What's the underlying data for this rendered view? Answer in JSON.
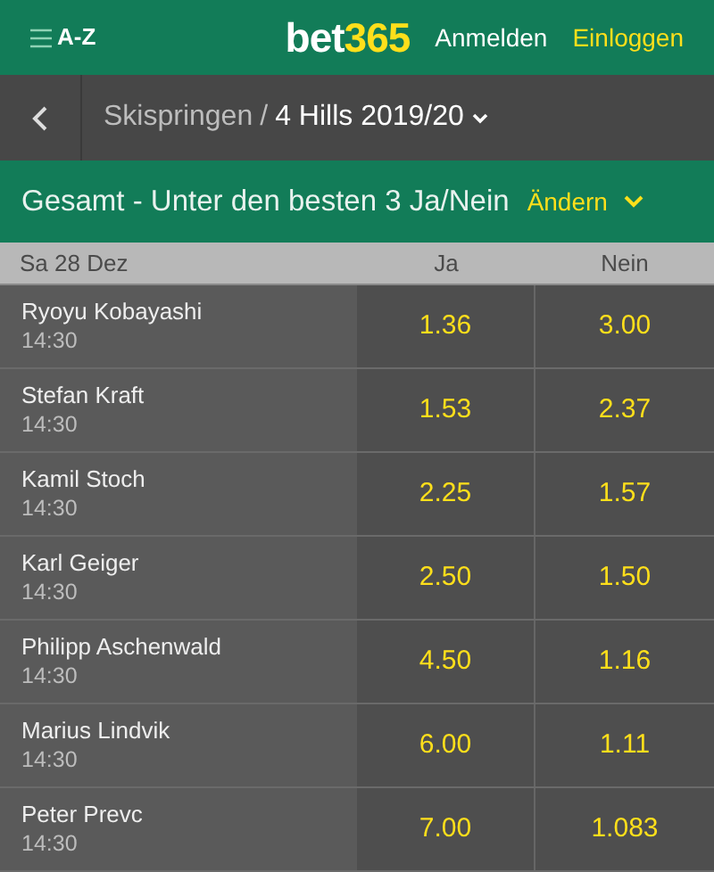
{
  "header": {
    "menu_label": "A-Z",
    "logo": [
      "bet",
      "365"
    ],
    "links": [
      {
        "label": "Anmelden",
        "kind": "plain"
      },
      {
        "label": "Einloggen",
        "kind": "highlight"
      }
    ]
  },
  "breadcrumb": {
    "sport": "Skispringen",
    "separator": "/",
    "event": "4 Hills 2019/20"
  },
  "market": {
    "title": "Gesamt - Unter den besten 3 Ja/Nein",
    "change_label": "Ändern"
  },
  "table": {
    "columns": [
      "Sa 28 Dez",
      "Ja",
      "Nein"
    ],
    "rows": [
      {
        "name": "Ryoyu Kobayashi",
        "time": "14:30",
        "odds": [
          "1.36",
          "3.00"
        ]
      },
      {
        "name": "Stefan Kraft",
        "time": "14:30",
        "odds": [
          "1.53",
          "2.37"
        ]
      },
      {
        "name": "Kamil Stoch",
        "time": "14:30",
        "odds": [
          "2.25",
          "1.57"
        ]
      },
      {
        "name": "Karl Geiger",
        "time": "14:30",
        "odds": [
          "2.50",
          "1.50"
        ]
      },
      {
        "name": "Philipp Aschenwald",
        "time": "14:30",
        "odds": [
          "4.50",
          "1.16"
        ]
      },
      {
        "name": "Marius Lindvik",
        "time": "14:30",
        "odds": [
          "6.00",
          "1.11"
        ]
      },
      {
        "name": "Peter Prevc",
        "time": "14:30",
        "odds": [
          "7.00",
          "1.083"
        ]
      }
    ]
  }
}
